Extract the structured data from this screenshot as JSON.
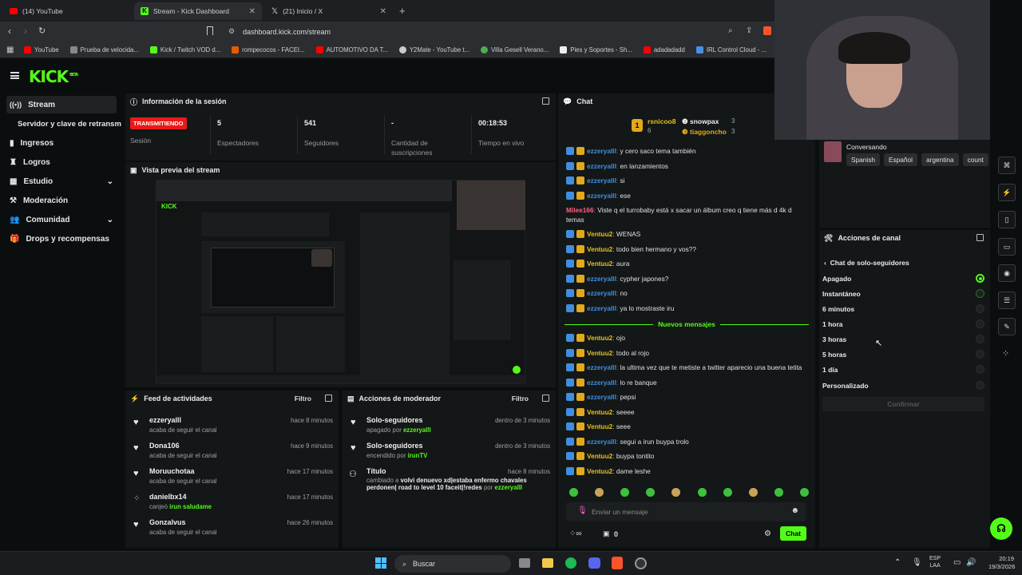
{
  "browser": {
    "tabs": [
      {
        "label": "(14) YouTube",
        "color": "#ff0000"
      },
      {
        "label": "Stream - Kick Dashboard",
        "color": "#53fc18"
      },
      {
        "label": "(21) Inicio / X",
        "color": "#dddddd"
      }
    ],
    "url": "dashboard.kick.com/stream",
    "bookmarks": [
      {
        "label": "YouTube",
        "color": "#ff0000"
      },
      {
        "label": "Prueba de velocida...",
        "color": "#888888"
      },
      {
        "label": "Kick / Twitch VOD d...",
        "color": "#53fc18"
      },
      {
        "label": "rompecocos - FACEI...",
        "color": "#e65c00"
      },
      {
        "label": "AUTOMOTIVO DA T...",
        "color": "#ff0000"
      },
      {
        "label": "Y2Mate - YouTube t...",
        "color": "#cccccc"
      },
      {
        "label": "Villa Gesell Verano...",
        "color": "#4caf50"
      },
      {
        "label": "Pies y Soportes - Sh...",
        "color": "#eeeeee"
      },
      {
        "label": "adadadadd",
        "color": "#ff0000"
      },
      {
        "label": "IRL Control Cloud - ...",
        "color": "#4a90e2"
      }
    ]
  },
  "kick": {
    "logo": "KICK",
    "beta": "BETA"
  },
  "sidebar": [
    {
      "label": "Stream",
      "icon": "broadcast-icon",
      "active": true
    },
    {
      "label": "Servidor y clave de retransm",
      "icon": "",
      "sub": true
    },
    {
      "label": "Ingresos",
      "icon": "chart-icon"
    },
    {
      "label": "Logros",
      "icon": "trophy-icon"
    },
    {
      "label": "Estudio",
      "icon": "grid-icon",
      "chevron": true
    },
    {
      "label": "Moderación",
      "icon": "hammer-icon"
    },
    {
      "label": "Comunidad",
      "icon": "people-icon",
      "chevron": true
    },
    {
      "label": "Drops y recompensas",
      "icon": "gift-icon"
    }
  ],
  "session": {
    "title": "Información de la sesión",
    "status": "TRANSMITIENDO",
    "status_label": "Sesión",
    "viewers": "5",
    "viewers_label": "Espectadores",
    "followers": "541",
    "followers_label": "Seguidores",
    "subs": "-",
    "subs_label": "Cantidad de suscripciones",
    "live_time": "00:18:53",
    "live_label": "Tiempo en vivo"
  },
  "preview": {
    "title": "Vista previa del stream"
  },
  "activity": {
    "title": "Feed de actividades",
    "filter": "Filtro",
    "items": [
      {
        "name": "ezzeryalll",
        "time": "hace 8 minutos",
        "desc": "acaba de seguir el canal",
        "icon": "heart-icon"
      },
      {
        "name": "Dona106",
        "time": "hace 9 minutos",
        "desc": "acaba de seguir el canal",
        "icon": "heart-icon"
      },
      {
        "name": "Moruuchotaa",
        "time": "hace 17 minutos",
        "desc": "acaba de seguir el canal",
        "icon": "heart-icon"
      },
      {
        "name": "danielbx14",
        "time": "hace 17 minutos",
        "desc": "canjeó",
        "reward": "irun saludame",
        "icon": "redeem-icon"
      },
      {
        "name": "Gonzalvus",
        "time": "hace 26 minutos",
        "desc": "acaba de seguir el canal",
        "icon": "heart-icon"
      }
    ]
  },
  "modactions": {
    "title": "Acciones de moderador",
    "filter": "Filtro",
    "items": [
      {
        "name": "Solo-seguidores",
        "time": "dentro de 3 minutos",
        "desc": "apagado por",
        "by": "ezzeryalll"
      },
      {
        "name": "Solo-seguidores",
        "time": "dentro de 3 minutos",
        "desc": "encendido por",
        "by": "irunTV"
      },
      {
        "name": "Título",
        "time": "hace 8 minutos",
        "desc": "cambiado a",
        "value": "volvi denuevo xd|estaba enfermo chavales perdonen| road to level 10 faceit|!redes",
        "by2": "por",
        "by": "ezzeryalll"
      }
    ]
  },
  "chat": {
    "title": "Chat",
    "top": [
      {
        "name": "rsnicoo8",
        "count": "6"
      },
      {
        "name": "snowpax",
        "count": "3"
      },
      {
        "name": "tiaggoncho",
        "count": "3"
      }
    ],
    "messages": [
      {
        "user": "ezzeryalll",
        "text": "y cero saco tema también",
        "color": "#3d8fe0"
      },
      {
        "user": "ezzeryalll",
        "text": "en lanzamientos",
        "color": "#3d8fe0"
      },
      {
        "user": "ezzeryalll",
        "text": "si",
        "color": "#3d8fe0"
      },
      {
        "user": "ezzeryalll",
        "text": "ese",
        "color": "#3d8fe0"
      },
      {
        "user": "Milee166",
        "text": "Viste q el turrobaby está x sacar un álbum creo q tiene más d 4k d temas",
        "color": "#ff5f87"
      },
      {
        "user": "Ventuu2",
        "text": "WENAS",
        "color": "#e3c21b"
      },
      {
        "user": "Ventuu2",
        "text": "todo bien hermano y vos??",
        "color": "#e3c21b"
      },
      {
        "user": "Ventuu2",
        "text": "aura",
        "color": "#e3c21b"
      },
      {
        "user": "ezzeryalll",
        "text": "cypher japones?",
        "color": "#3d8fe0"
      },
      {
        "user": "ezzeryalll",
        "text": "no",
        "color": "#3d8fe0"
      },
      {
        "user": "ezzeryalll",
        "text": "ya lo mostraste iru",
        "color": "#3d8fe0"
      }
    ],
    "new_label": "Nuevos mensajes",
    "messages2": [
      {
        "user": "Ventuu2",
        "text": "ojo",
        "color": "#e3c21b"
      },
      {
        "user": "Ventuu2",
        "text": "todo al rojo",
        "color": "#e3c21b"
      },
      {
        "user": "ezzeryalll",
        "text": "la ultima vez que te metiste a twitter aparecio una buena tetita",
        "color": "#3d8fe0"
      },
      {
        "user": "ezzeryalll",
        "text": "lo re banque",
        "color": "#3d8fe0"
      },
      {
        "user": "ezzeryalll",
        "text": "pepsi",
        "color": "#3d8fe0"
      },
      {
        "user": "Ventuu2",
        "text": "seeee",
        "color": "#e3c21b"
      },
      {
        "user": "Ventuu2",
        "text": "seee",
        "color": "#e3c21b"
      },
      {
        "user": "ezzeryalll",
        "text": "segui a irun buypa trolo",
        "color": "#3d8fe0"
      },
      {
        "user": "Ventuu2",
        "text": "buypa tontito",
        "color": "#e3c21b"
      },
      {
        "user": "Ventuu2",
        "text": "dame leshe",
        "color": "#e3c21b"
      }
    ],
    "input_placeholder": "Enviar un mensaje",
    "count": "0",
    "send_label": "Chat"
  },
  "channel": {
    "category": "Conversando",
    "tags": [
      "Spanish",
      "Español",
      "argentina",
      "count"
    ],
    "actions_title": "Acciones de canal",
    "back_label": "Chat de solo-seguidores",
    "options": [
      "Apagado",
      "Instantáneo",
      "6 minutos",
      "1 hora",
      "3 horas",
      "5 horas",
      "1 día",
      "Personalizado"
    ],
    "selected": "Apagado",
    "confirm_label": "Confirmar"
  },
  "taskbar": {
    "search": "Buscar",
    "lang1": "ESP",
    "lang2": "LAA",
    "time": "20:19",
    "date": "19/3/2026"
  },
  "colors": {
    "accent": "#53fc18",
    "live": "#e91916",
    "bg": "#0b0e0f",
    "panel": "#141718"
  }
}
